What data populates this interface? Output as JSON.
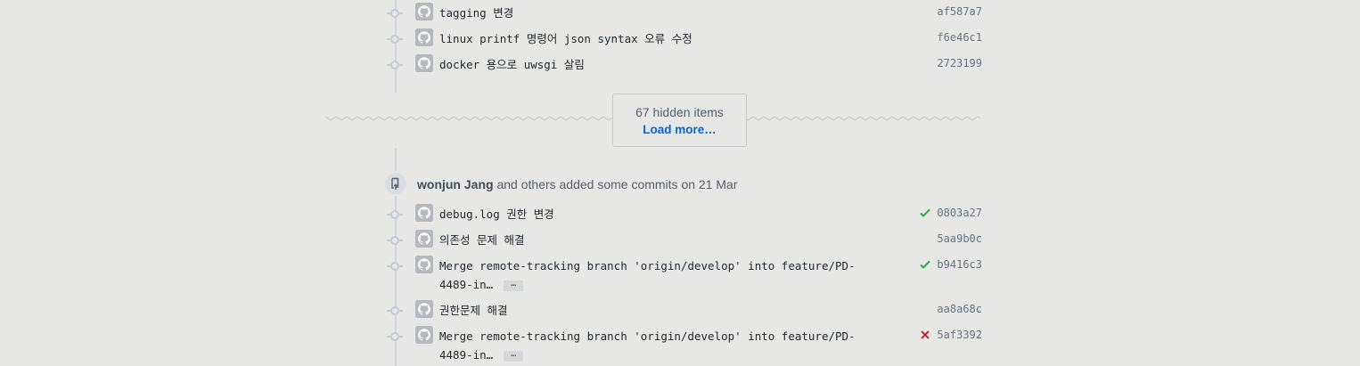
{
  "commits_top": [
    {
      "message": "tagging 변경",
      "sha": "af587a7",
      "status": "none"
    },
    {
      "message": "linux printf 명령어 json syntax 오류 수정",
      "sha": "f6e46c1",
      "status": "none"
    },
    {
      "message": "docker 용으로 uwsgi 살림",
      "sha": "2723199",
      "status": "none"
    }
  ],
  "hidden_items": {
    "count_text": "67 hidden items",
    "load_more_label": "Load more…"
  },
  "push_event": {
    "author": "wonjun Jang",
    "description": " and others added some commits on 21 Mar"
  },
  "commits_bottom": [
    {
      "message": "debug.log 권한 변경",
      "sha": "0803a27",
      "status": "success"
    },
    {
      "message": "의존성 문제 해결",
      "sha": "5aa9b0c",
      "status": "none"
    },
    {
      "message": "Merge remote-tracking branch 'origin/develop' into feature/PD-4489-in…",
      "sha": "b9416c3",
      "status": "success",
      "expandable": true
    },
    {
      "message": "권한문제 해결",
      "sha": "aa8a68c",
      "status": "none"
    },
    {
      "message": "Merge remote-tracking branch 'origin/develop' into feature/PD-4489-in…",
      "sha": "5af3392",
      "status": "failure",
      "expandable": true
    }
  ],
  "ellipsis_label": "…",
  "colors": {
    "success": "#28a745",
    "failure": "#cb2431",
    "link": "#0366d6"
  },
  "icons": {
    "avatar": "github-avatar-icon",
    "push": "repo-push-icon",
    "success": "check-icon",
    "failure": "x-icon"
  }
}
